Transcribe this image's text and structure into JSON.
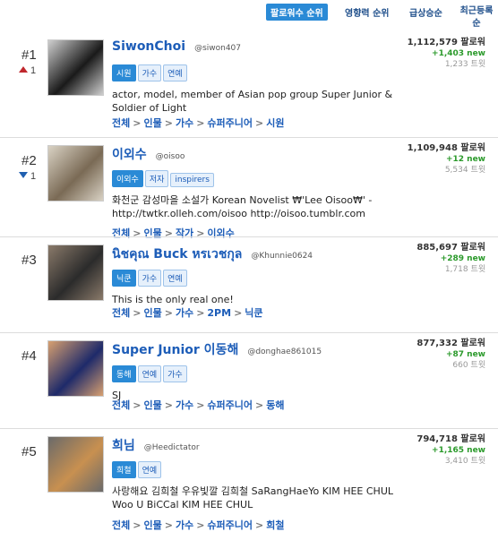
{
  "tabs": [
    {
      "label": "팔로워수 순위",
      "active": true
    },
    {
      "label": "영향력 순위",
      "active": false
    },
    {
      "label": "급상승순",
      "active": false
    },
    {
      "label": "최근등록순",
      "active": false
    }
  ],
  "entries": [
    {
      "rank": "#1",
      "change_dir": "up",
      "change": "1",
      "name": "SiwonChoi",
      "handle": "@siwon407",
      "tags": [
        "시원",
        "가수",
        "연예"
      ],
      "bio": "actor, model, member of Asian pop group Super Junior & Soldier of Light",
      "crumbs": [
        "전체",
        "인물",
        "가수",
        "슈퍼주니어",
        "시원"
      ],
      "followers": "1,112,579 팔로워",
      "new": "+1,403 new",
      "tweets": "1,233 트윗",
      "avatar_colors": [
        "#1a1a1a",
        "#cfcfcf"
      ]
    },
    {
      "rank": "#2",
      "change_dir": "down",
      "change": "1",
      "name": "이외수",
      "handle": "@oisoo",
      "tags": [
        "이외수",
        "저자",
        "inspirers"
      ],
      "bio": "화천군 감성마을 소설가 Korean Novelist ₩'Lee Oisoo₩' - http://twtkr.olleh.com/oisoo http://oisoo.tumblr.com",
      "crumbs": [
        "전체",
        "인물",
        "작가",
        "이외수"
      ],
      "followers": "1,109,948 팔로워",
      "new": "+12 new",
      "tweets": "5,534 트윗",
      "avatar_colors": [
        "#7a6a55",
        "#d9d2c4"
      ]
    },
    {
      "rank": "#3",
      "change_dir": "none",
      "change": "",
      "name": "นิชคุณ Buck หรเวชกุล",
      "handle": "@Khunnie0624",
      "tags": [
        "닉쿤",
        "가수",
        "연예"
      ],
      "bio": "This is the only real one!",
      "crumbs": [
        "전체",
        "인물",
        "가수",
        "2PM",
        "닉쿤"
      ],
      "followers": "885,697 팔로워",
      "new": "+289 new",
      "tweets": "1,718 트윗",
      "avatar_colors": [
        "#2b2b2b",
        "#8a7a6a"
      ]
    },
    {
      "rank": "#4",
      "change_dir": "none",
      "change": "",
      "name": "Super Junior 이동해",
      "handle": "@donghae861015",
      "tags": [
        "동해",
        "연예",
        "가수"
      ],
      "bio": "SJ",
      "crumbs": [
        "전체",
        "인물",
        "가수",
        "슈퍼주니어",
        "동해"
      ],
      "followers": "877,332 팔로워",
      "new": "+87 new",
      "tweets": "660 트윗",
      "avatar_colors": [
        "#1e2a6a",
        "#d8a070"
      ]
    },
    {
      "rank": "#5",
      "change_dir": "none",
      "change": "",
      "name": "희님",
      "handle": "@Heedictator",
      "tags": [
        "희철",
        "연예"
      ],
      "bio": "사랑해요 김희철 우유빛깔 김희철 SaRangHaeYo KIM HEE CHUL Woo U BiCCal KIM HEE CHUL",
      "crumbs": [
        "전체",
        "인물",
        "가수",
        "슈퍼주니어",
        "희철"
      ],
      "followers": "794,718 팔로워",
      "new": "+1,165 new",
      "tweets": "3,410 트윗",
      "avatar_colors": [
        "#c89050",
        "#6a6a6a"
      ]
    }
  ]
}
